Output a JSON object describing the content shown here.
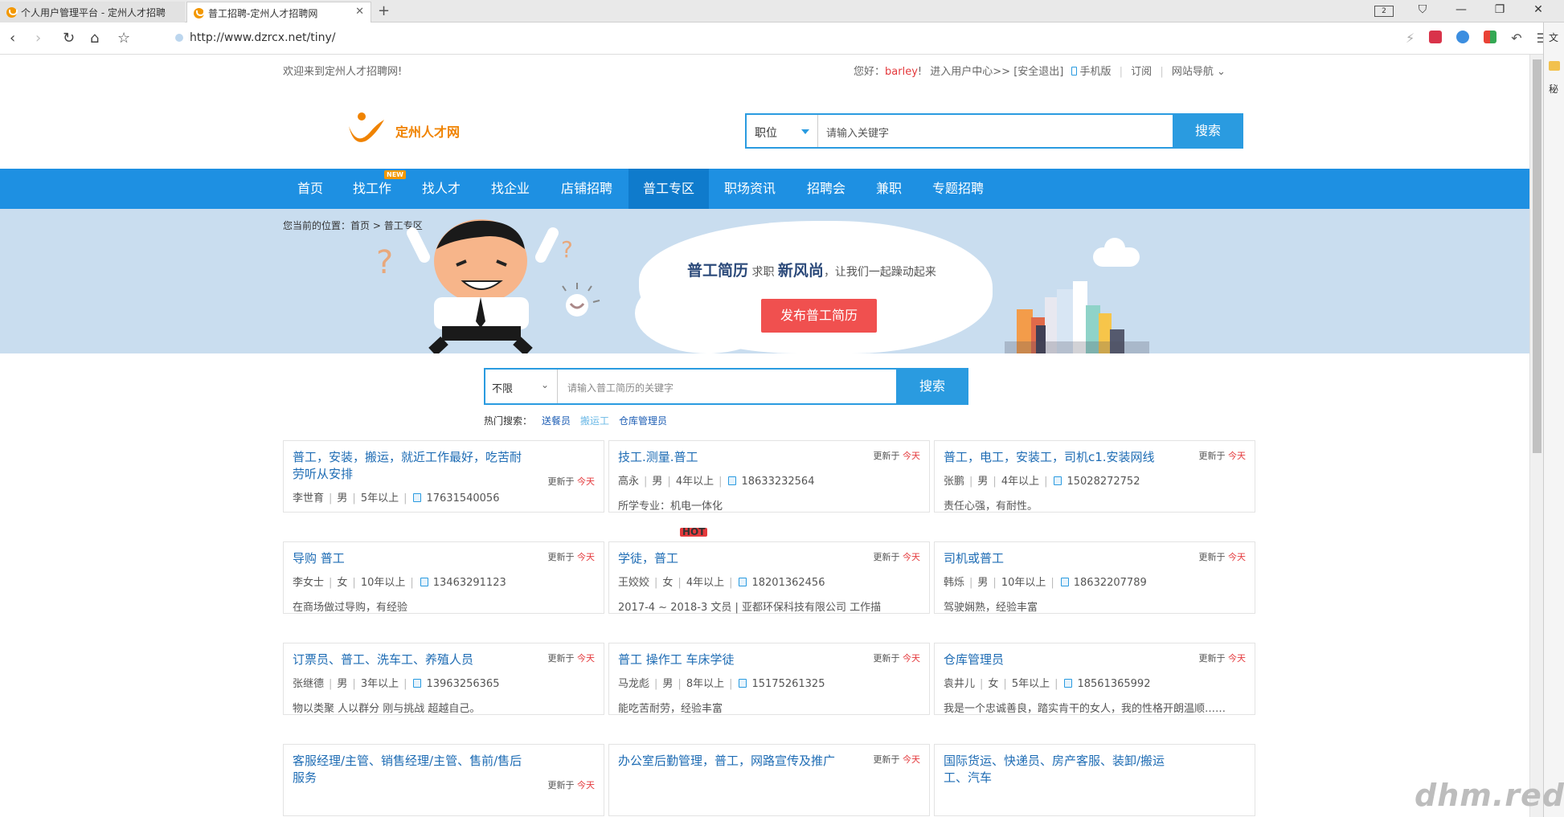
{
  "browser": {
    "tabs": [
      {
        "title": "个人用户管理平台 - 定州人才招聘"
      },
      {
        "title": "普工招聘-定州人才招聘网"
      }
    ],
    "new_tab": "+",
    "tab_close": "✕",
    "window_counter": "2",
    "url": "http://www.dzrcx.net/tiny/",
    "side_labels": [
      "文",
      "秘"
    ]
  },
  "topbar": {
    "welcome": "欢迎来到定州人才招聘网!",
    "greeting": "您好：",
    "username": "barley",
    "excl": "!",
    "user_center": "进入用户中心>>",
    "logout": "[安全退出]",
    "mobile": "手机版",
    "subscribe": "订阅",
    "site_nav": "网站导航",
    "divider": "|"
  },
  "header": {
    "logo_text": "定州人才网",
    "search_type": "职位",
    "search_placeholder": "请输入关键字",
    "search_button": "搜索"
  },
  "nav": {
    "items": [
      {
        "label": "首页"
      },
      {
        "label": "找工作",
        "badge": "NEW"
      },
      {
        "label": "找人才"
      },
      {
        "label": "找企业"
      },
      {
        "label": "店铺招聘"
      },
      {
        "label": "普工专区",
        "badge": "HOT"
      },
      {
        "label": "职场资讯"
      },
      {
        "label": "招聘会"
      },
      {
        "label": "兼职"
      },
      {
        "label": "专题招聘"
      }
    ],
    "active_index": 5
  },
  "banner": {
    "crumb_prefix": "您当前的位置：",
    "crumb_home": "首页",
    "crumb_sep": ">",
    "crumb_current": "普工专区",
    "slogan_a": "普工简历",
    "slogan_b": "求职",
    "slogan_c": "新风尚",
    "slogan_d": "，让我们一起躁动起来",
    "publish_button": "发布普工简历"
  },
  "resume_search": {
    "filter": "不限",
    "placeholder": "请输入普工简历的关键字",
    "button": "搜索",
    "hot_label": "热门搜索：",
    "hot_terms": [
      "送餐员",
      "搬运工",
      "仓库管理员"
    ]
  },
  "cards": {
    "update_prefix": "更新于",
    "update_today": "今天",
    "items": [
      {
        "title": "普工，安装，搬运，就近工作最好，吃苦耐劳听从安排",
        "name": "李世育",
        "gender": "男",
        "exp": "5年以上",
        "phone": "17631540056",
        "desc": ""
      },
      {
        "title": "技工.测量.普工",
        "name": "高永",
        "gender": "男",
        "exp": "4年以上",
        "phone": "18633232564",
        "desc": "所学专业：机电一体化"
      },
      {
        "title": "普工，电工，安装工，司机c1.安装网线",
        "name": "张鹏",
        "gender": "男",
        "exp": "4年以上",
        "phone": "15028272752",
        "desc": "责任心强，有耐性。"
      },
      {
        "title": "导购 普工",
        "name": "李女士",
        "gender": "女",
        "exp": "10年以上",
        "phone": "13463291123",
        "desc": "在商场做过导购，有经验"
      },
      {
        "title": "学徒，普工",
        "name": "王姣姣",
        "gender": "女",
        "exp": "4年以上",
        "phone": "18201362456",
        "desc": "2017-4 ~ 2018-3 文员 | 亚都环保科技有限公司 工作描"
      },
      {
        "title": "司机或普工",
        "name": "韩烁",
        "gender": "男",
        "exp": "10年以上",
        "phone": "18632207789",
        "desc": "驾驶娴熟，经验丰富"
      },
      {
        "title": "订票员、普工、洗车工、养殖人员",
        "name": "张继德",
        "gender": "男",
        "exp": "3年以上",
        "phone": "13963256365",
        "desc": "物以类聚 人以群分 刚与挑战 超越自己。"
      },
      {
        "title": "普工 操作工 车床学徒",
        "name": "马龙彪",
        "gender": "男",
        "exp": "8年以上",
        "phone": "15175261325",
        "desc": "能吃苦耐劳，经验丰富"
      },
      {
        "title": "仓库管理员",
        "name": "袁井儿",
        "gender": "女",
        "exp": "5年以上",
        "phone": "18561365992",
        "desc": "我是一个忠诚善良，踏实肯干的女人，我的性格开朗温顺……"
      },
      {
        "title": "客服经理/主管、销售经理/主管、售前/售后服务",
        "name": "",
        "gender": "",
        "exp": "",
        "phone": "",
        "desc": ""
      },
      {
        "title": "办公室后勤管理，普工，网路宣传及推广",
        "name": "",
        "gender": "",
        "exp": "",
        "phone": "",
        "desc": ""
      },
      {
        "title": "国际货运、快递员、房产客服、装卸/搬运工、汽车",
        "name": "",
        "gender": "",
        "exp": "",
        "phone": "",
        "desc": ""
      }
    ]
  },
  "watermark": "dhm.red",
  "colors": {
    "primary": "#1e90e2",
    "nav_active": "#0f7bcc",
    "banner_bg": "#c9ddef",
    "publish_button": "#f0504f",
    "logo_orange": "#f08300",
    "link_blue": "#1e6cb4",
    "today_red": "#e4393c"
  }
}
